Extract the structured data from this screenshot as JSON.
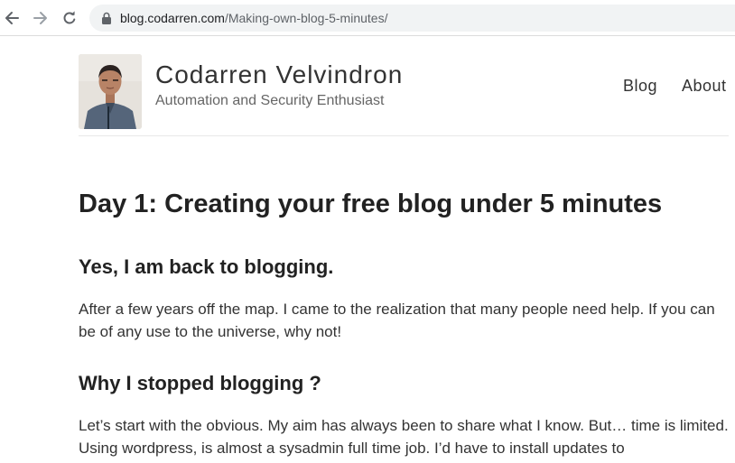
{
  "browser": {
    "url_host": "blog.codarren.com",
    "url_path": "/Making-own-blog-5-minutes/"
  },
  "site": {
    "title": "Codarren Velvindron",
    "tagline": "Automation and Security Enthusiast",
    "nav": {
      "blog": "Blog",
      "about": "About"
    }
  },
  "post": {
    "title": "Day 1: Creating your free blog under 5 minutes",
    "sections": [
      {
        "heading": "Yes, I am back to blogging.",
        "body": "After a few years off the map. I came to the realization that many people need help. If you can be of any use to the universe, why not!"
      },
      {
        "heading": "Why I stopped blogging ?",
        "body": "Let’s start with the obvious. My aim has always been to share what I know. But… time is limited. Using wordpress, is almost a sysadmin full time job. I’d have to install updates to"
      }
    ]
  },
  "icons": {
    "back": "arrow-left-icon",
    "forward": "arrow-right-icon",
    "reload": "reload-icon",
    "lock": "lock-icon"
  }
}
